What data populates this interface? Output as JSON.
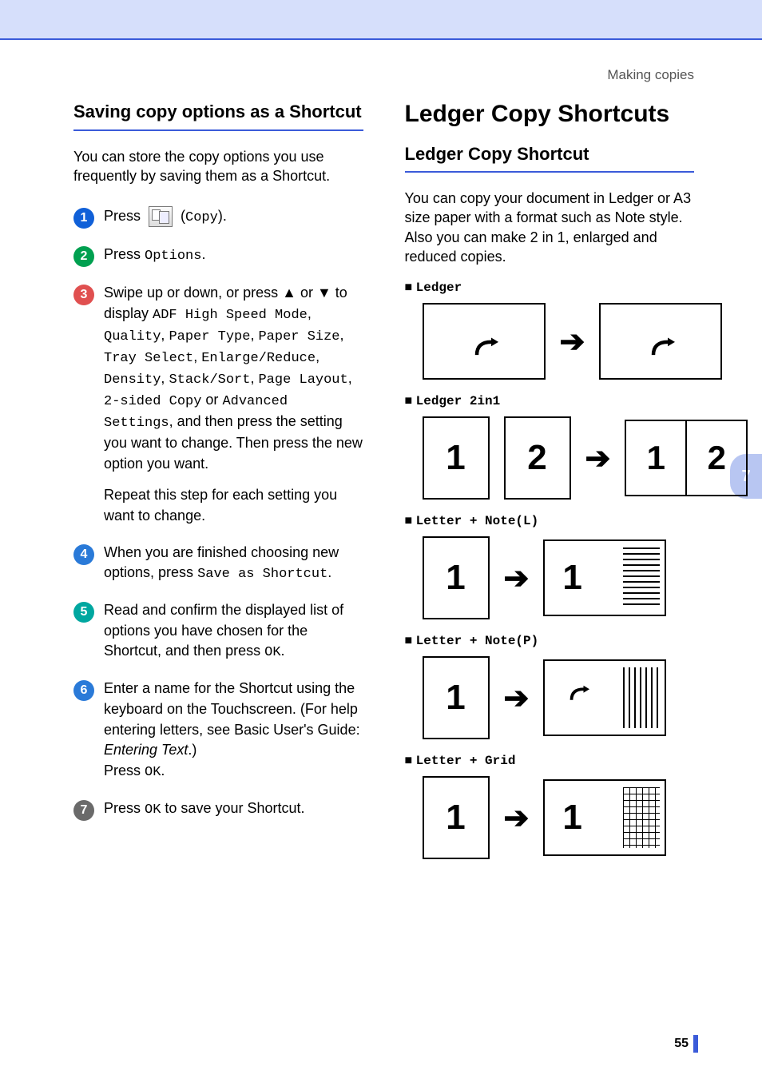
{
  "header": {
    "section": "Making copies"
  },
  "left": {
    "h2": "Saving copy options as a Shortcut",
    "intro": "You can store the copy options you use frequently by saving them as a Shortcut.",
    "steps": {
      "1": {
        "press": "Press ",
        "copy_label": "Copy"
      },
      "2": {
        "press": "Press ",
        "options": "Options",
        "dot": "."
      },
      "3": {
        "line1a": "Swipe up or down, or press ",
        "up": "▲",
        "or": " or ",
        "down": "▼",
        "line1b": " to display ",
        "opt1": "ADF High Speed Mode",
        "c1": ", ",
        "opt2": "Quality",
        "c2": ", ",
        "opt3": "Paper Type",
        "c3": ", ",
        "opt4": "Paper Size",
        "c4": ", ",
        "opt5": "Tray Select",
        "c5": ", ",
        "opt6": "Enlarge/Reduce",
        "c6": ", ",
        "opt7": "Density",
        "c7": ", ",
        "opt8": "Stack/Sort",
        "c8": ", ",
        "opt9": "Page Layout",
        "c9": ", ",
        "opt10": "2-sided Copy",
        "or2": " or ",
        "opt11": "Advanced Settings",
        "tail": ", and then press the setting you want to change. Then press the new option you want.",
        "repeat": "Repeat this step for each setting you want to change."
      },
      "4": {
        "text1": "When you are finished choosing new options, press ",
        "save": "Save as Shortcut",
        "dot": "."
      },
      "5": {
        "text1": "Read and confirm the displayed list of options you have chosen for the Shortcut, and then press ",
        "ok": "OK",
        "dot": "."
      },
      "6": {
        "text1": "Enter a name for the Shortcut using the keyboard on the Touchscreen. (For help entering letters, see Basic User's Guide: ",
        "entering": "Entering Text",
        "text2": ".)",
        "press": "Press ",
        "ok": "OK",
        "dot": "."
      },
      "7": {
        "press": "Press ",
        "ok": "OK",
        "tail": " to save your Shortcut."
      }
    }
  },
  "right": {
    "h1": "Ledger Copy Shortcuts",
    "h2": "Ledger Copy Shortcut",
    "intro": "You can copy your document in Ledger or A3 size paper with a format such as Note style. Also you can make 2 in 1, enlarged and reduced copies.",
    "labels": {
      "ledger": "Ledger",
      "ledger2in1": "Ledger 2in1",
      "letterNoteL": "Letter + Note(L)",
      "letterNoteP": "Letter + Note(P)",
      "letterGrid": "Letter + Grid"
    },
    "nums": {
      "one": "1",
      "two": "2"
    }
  },
  "chapter_tab": "7",
  "page_number": "55"
}
